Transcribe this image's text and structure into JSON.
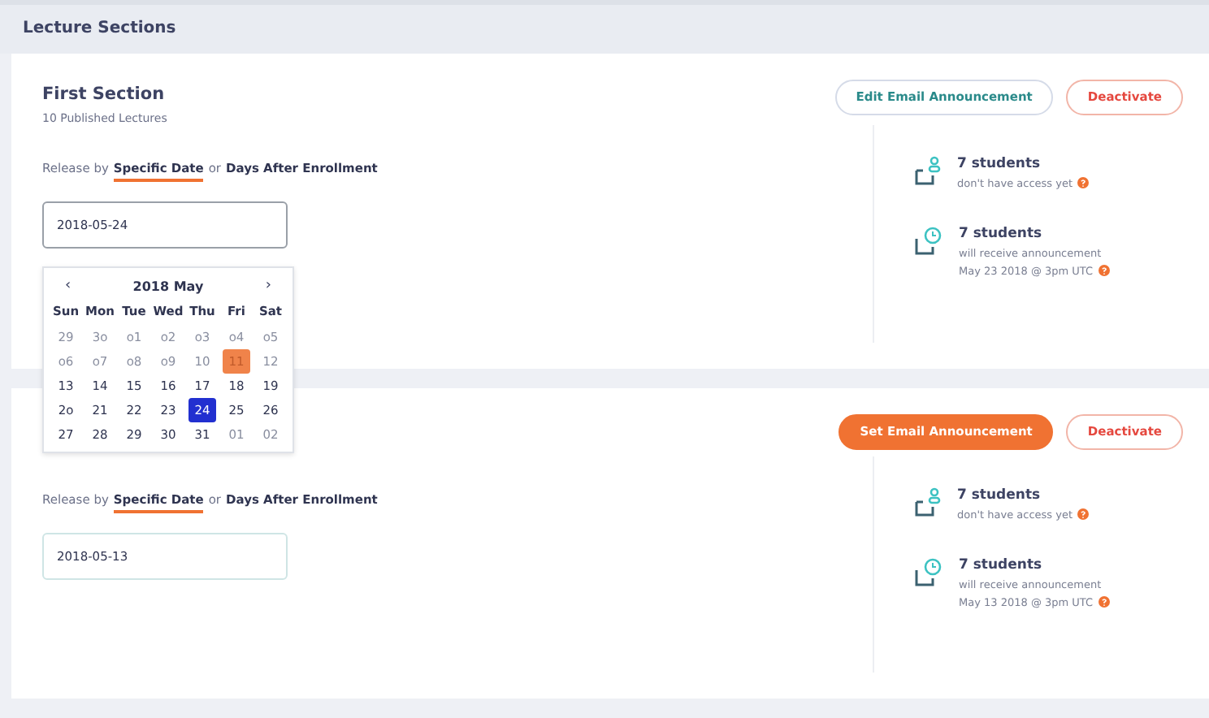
{
  "page_title": "Lecture Sections",
  "sections": [
    {
      "title": "First Section",
      "subtitle": "10 Published Lectures",
      "release_label": "Release by",
      "release_or": "or",
      "release_options": [
        {
          "label": "Specific Date",
          "selected": true
        },
        {
          "label": "Days After Enrollment",
          "selected": false
        }
      ],
      "date_value": "2018-05-24",
      "date_focused": true,
      "buttons": [
        {
          "label": "Edit Email Announcement",
          "kind": "outline"
        },
        {
          "label": "Deactivate",
          "kind": "danger"
        }
      ],
      "stats": [
        {
          "kind": "access",
          "count": "7 students",
          "lines": [
            "don't have access yet"
          ]
        },
        {
          "kind": "clock",
          "count": "7 students",
          "lines": [
            "will receive announcement",
            "May 23 2018 @ 3pm UTC"
          ]
        }
      ]
    },
    {
      "release_label": "Release by",
      "release_or": "or",
      "release_options": [
        {
          "label": "Specific Date",
          "selected": true
        },
        {
          "label": "Days After Enrollment",
          "selected": false
        }
      ],
      "date_value": "2018-05-13",
      "date_focused": false,
      "buttons": [
        {
          "label": "Set Email Announcement",
          "kind": "primary"
        },
        {
          "label": "Deactivate",
          "kind": "danger"
        }
      ],
      "stats": [
        {
          "kind": "access",
          "count": "7 students",
          "lines": [
            "don't have access yet"
          ]
        },
        {
          "kind": "clock",
          "count": "7 students",
          "lines": [
            "will receive announcement",
            "May 13 2018 @ 3pm UTC"
          ]
        }
      ]
    }
  ],
  "calendar": {
    "prev": "‹",
    "next": "›",
    "title": "2018 May",
    "weekdays": [
      "Sun",
      "Mon",
      "Tue",
      "Wed",
      "Thu",
      "Fri",
      "Sat"
    ],
    "days": [
      {
        "label": "29",
        "kind": "outside",
        "selected": false
      },
      {
        "label": "3o",
        "kind": "outside",
        "selected": false
      },
      {
        "label": "o1",
        "kind": "outside",
        "selected": false
      },
      {
        "label": "o2",
        "kind": "outside",
        "selected": false
      },
      {
        "label": "o3",
        "kind": "outside",
        "selected": false
      },
      {
        "label": "o4",
        "kind": "outside",
        "selected": false
      },
      {
        "label": "o5",
        "kind": "outside",
        "selected": false
      },
      {
        "label": "o6",
        "kind": "outside",
        "selected": false
      },
      {
        "label": "o7",
        "kind": "outside",
        "selected": false
      },
      {
        "label": "o8",
        "kind": "outside",
        "selected": false
      },
      {
        "label": "o9",
        "kind": "outside",
        "selected": false
      },
      {
        "label": "10",
        "kind": "outside",
        "selected": false
      },
      {
        "label": "11",
        "kind": "today",
        "selected": false
      },
      {
        "label": "12",
        "kind": "outside",
        "selected": false
      },
      {
        "label": "13",
        "kind": "current",
        "selected": false
      },
      {
        "label": "14",
        "kind": "current",
        "selected": false
      },
      {
        "label": "15",
        "kind": "current",
        "selected": false
      },
      {
        "label": "16",
        "kind": "current",
        "selected": false
      },
      {
        "label": "17",
        "kind": "current",
        "selected": false
      },
      {
        "label": "18",
        "kind": "current",
        "selected": false
      },
      {
        "label": "19",
        "kind": "current",
        "selected": false
      },
      {
        "label": "2o",
        "kind": "current",
        "selected": false
      },
      {
        "label": "21",
        "kind": "current",
        "selected": false
      },
      {
        "label": "22",
        "kind": "current",
        "selected": false
      },
      {
        "label": "23",
        "kind": "current",
        "selected": false
      },
      {
        "label": "24",
        "kind": "current",
        "selected": true
      },
      {
        "label": "25",
        "kind": "current",
        "selected": false
      },
      {
        "label": "26",
        "kind": "current",
        "selected": false
      },
      {
        "label": "27",
        "kind": "current",
        "selected": false
      },
      {
        "label": "28",
        "kind": "current",
        "selected": false
      },
      {
        "label": "29",
        "kind": "current",
        "selected": false
      },
      {
        "label": "30",
        "kind": "current",
        "selected": false
      },
      {
        "label": "31",
        "kind": "current",
        "selected": false
      },
      {
        "label": "01",
        "kind": "outside",
        "selected": false
      },
      {
        "label": "02",
        "kind": "outside",
        "selected": false
      }
    ]
  }
}
